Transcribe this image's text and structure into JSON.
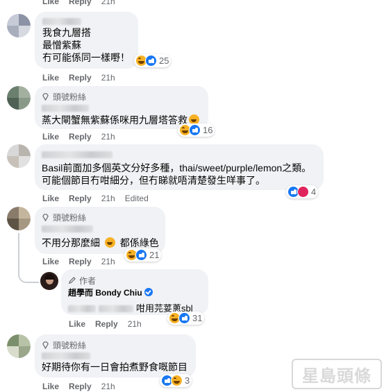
{
  "actions": {
    "like": "Like",
    "reply": "Reply"
  },
  "top_fragment": {
    "time": "21h"
  },
  "comments": [
    {
      "lines": [
        "我食九層搭",
        "最憎紫蘇",
        "冇可能係同一樣嘢！"
      ],
      "time": "21h",
      "reaction_count": "25"
    },
    {
      "badge": "頭號粉絲",
      "lines": [
        "蒸大閘蟹無紫蘇係咪用九層塔答救"
      ],
      "time": "21h",
      "reaction_count": "16"
    },
    {
      "lines": [
        "Basil前面加多個英文分好多種，thai/sweet/purple/lemon之類。",
        "可能個節目冇咁細分，但冇睇就唔清楚發生咩事了。"
      ],
      "time": "21h",
      "edited": "Edited",
      "reaction_count": "4"
    },
    {
      "badge": "頭號粉絲",
      "text_before": "不用分那麼細",
      "text_after": "都係綠色",
      "time": "21h",
      "reaction_count": "21"
    },
    {
      "badge": "頭號粉絲",
      "lines": [
        "好期待你有一日會拍煮野食嘅節目"
      ],
      "time": "21h",
      "reaction_count": "3"
    }
  ],
  "reply": {
    "badge": "作者",
    "author": "趙學而 Bondy Chiu",
    "text": "咁用芫荽蔥sbl",
    "time": "21h",
    "reaction_count": "31"
  },
  "watermark": "星島頭條"
}
